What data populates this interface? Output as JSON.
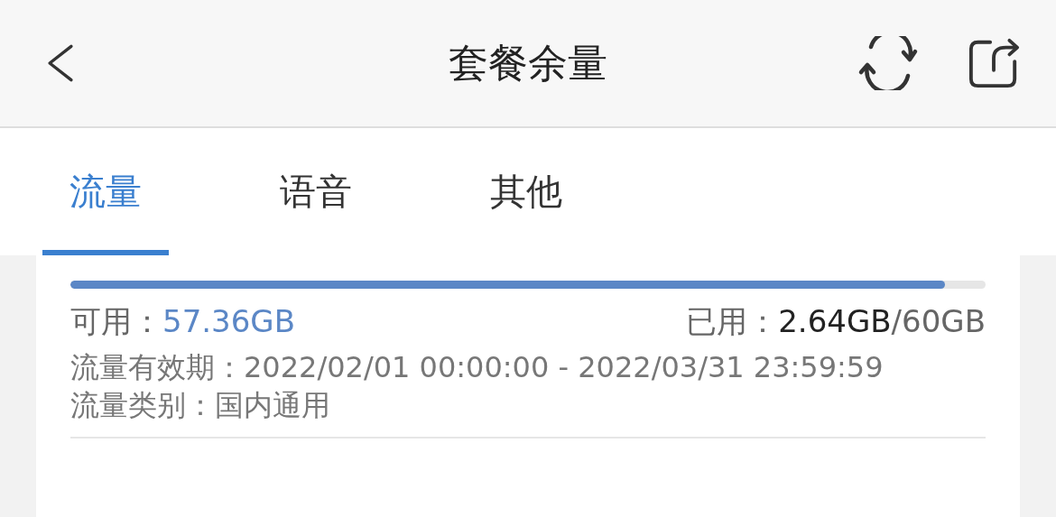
{
  "header": {
    "title": "套餐余量"
  },
  "tabs": [
    {
      "label": "流量",
      "selected": true
    },
    {
      "label": "语音",
      "selected": false
    },
    {
      "label": "其他",
      "selected": false
    }
  ],
  "usage": {
    "level": 0.956,
    "available_label": "可用：",
    "available_value": "57.36GB",
    "used_label": "已用：",
    "used_value": "2.64GB",
    "total_value": "/60GB",
    "validity_label": "流量有效期：",
    "validity_value": "2022/02/01 00:00:00 - 2022/03/31 23:59:59",
    "type_label": "流量类别：",
    "type_value": "国内通用"
  }
}
